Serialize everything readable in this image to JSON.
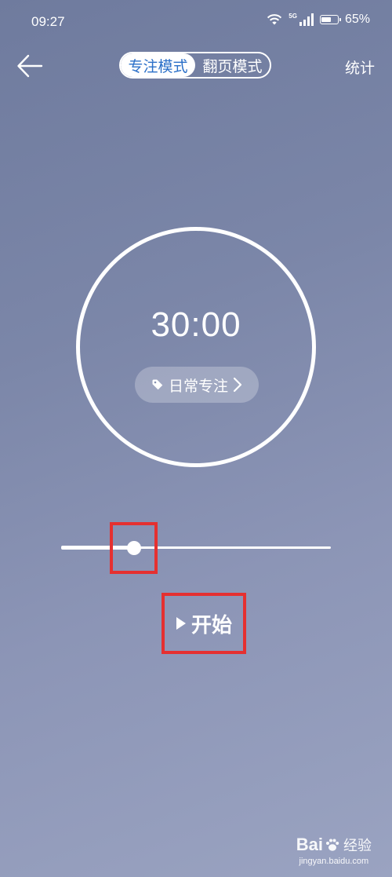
{
  "status_bar": {
    "time": "09:27",
    "network": "5G",
    "battery_percent": "65%",
    "battery_level": 0.65
  },
  "header": {
    "back_icon": "arrow-left-icon",
    "tabs": [
      {
        "label": "专注模式",
        "active": true
      },
      {
        "label": "翻页模式",
        "active": false
      }
    ],
    "stats_label": "统计"
  },
  "timer": {
    "value": "30:00",
    "tag_label": "日常专注",
    "tag_icon": "tag-icon",
    "tag_chevron": "chevron-right-icon"
  },
  "slider": {
    "position_fraction": 0.27
  },
  "start_button": {
    "label": "开始",
    "icon": "play-icon"
  },
  "watermark": {
    "brand": "Bai",
    "brand_tail": "经验",
    "sub": "jingyan.baidu.com"
  },
  "colors": {
    "accent_blue": "#2a6fc8",
    "highlight_red": "#e53030"
  }
}
